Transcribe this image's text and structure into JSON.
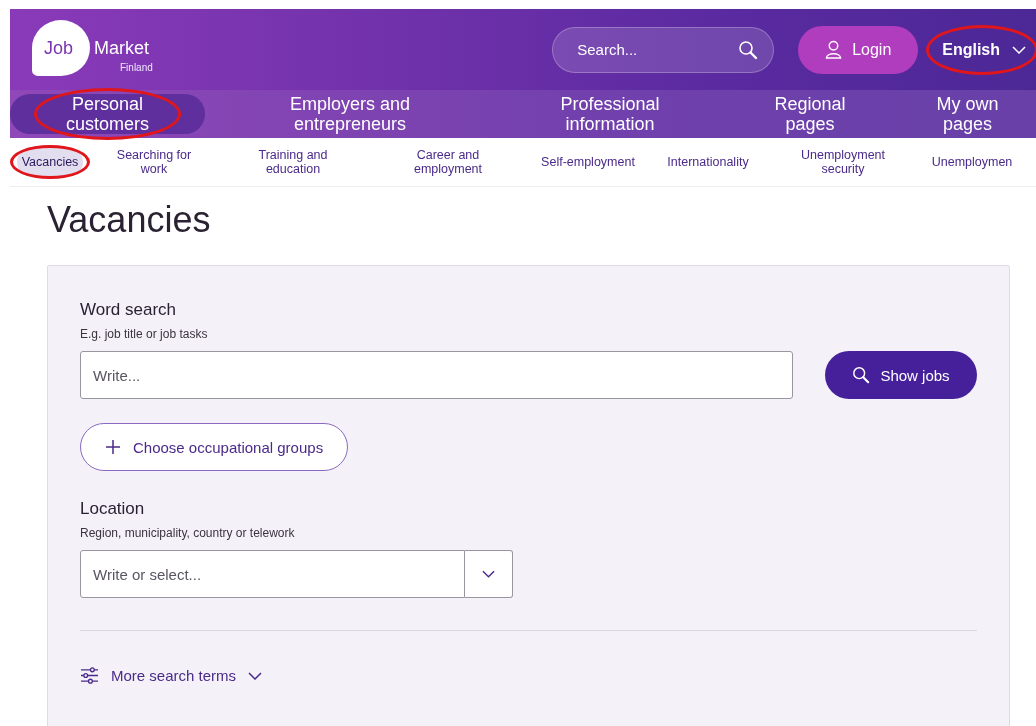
{
  "header": {
    "logo": {
      "word_1": "Job",
      "word_2": "Market",
      "subtitle": "Finland"
    },
    "search": {
      "placeholder": "Search..."
    },
    "login": {
      "label": "Login"
    },
    "language": {
      "label": "English",
      "circled": true
    }
  },
  "main_nav": [
    {
      "label": "Personal customers",
      "selected": true,
      "circled": true
    },
    {
      "label": "Employers and entrepreneurs",
      "selected": false,
      "circled": false
    },
    {
      "label": "Professional information",
      "selected": false,
      "circled": false
    },
    {
      "label": "Regional pages",
      "selected": false,
      "circled": false
    },
    {
      "label": "My own pages",
      "selected": false,
      "circled": false
    }
  ],
  "sub_nav": [
    {
      "label": "Vacancies",
      "selected": true,
      "circled": true
    },
    {
      "label": "Searching for work",
      "selected": false,
      "circled": false
    },
    {
      "label": "Training and education",
      "selected": false,
      "circled": false
    },
    {
      "label": "Career and employment",
      "selected": false,
      "circled": false
    },
    {
      "label": "Self-employment",
      "selected": false,
      "circled": false
    },
    {
      "label": "Internationality",
      "selected": false,
      "circled": false
    },
    {
      "label": "Unemployment security",
      "selected": false,
      "circled": false
    },
    {
      "label": "Unemploymen",
      "selected": false,
      "circled": false
    }
  ],
  "page_title": "Vacancies",
  "form": {
    "word_search": {
      "label": "Word search",
      "hint": "E.g. job title or job tasks",
      "placeholder": "Write..."
    },
    "show_jobs": "Show jobs",
    "occupational_groups": "Choose occupational groups",
    "location": {
      "label": "Location",
      "hint": "Region, municipality, country or telework",
      "placeholder": "Write or select..."
    },
    "more_terms": "More search terms"
  }
}
